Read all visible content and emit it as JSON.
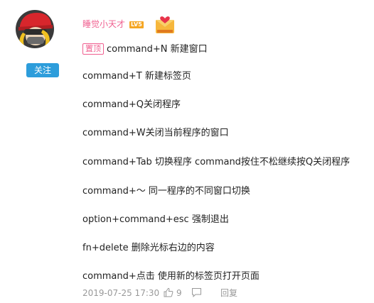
{
  "user": {
    "name": "睡觉小天才",
    "level": "LV5",
    "follow_label": "关注"
  },
  "post": {
    "pin_label": "置顶",
    "lines": [
      "command+N 新建窗口",
      "command+T 新建标签页",
      "command+Q关闭程序",
      "command+W关闭当前程序的窗口",
      "command+Tab 切换程序 command按住不松继续按Q关闭程序",
      "command+～ 同一程序的不同窗口切换",
      "option+command+esc 强制退出",
      "fn+delete 删除光标右边的内容",
      "command+点击 使用新的标签页打开页面"
    ]
  },
  "footer": {
    "datetime": "2019-07-25 17:30",
    "like_count": "9",
    "reply_label": "回复"
  },
  "colors": {
    "username": "#f06090",
    "follow_button": "#2d9ddb",
    "level_badge": "#f5a623",
    "meta_text": "#999999"
  },
  "icons": [
    "avatar-image",
    "gift-envelope-icon",
    "thumbs-up-icon",
    "comment-icon"
  ]
}
